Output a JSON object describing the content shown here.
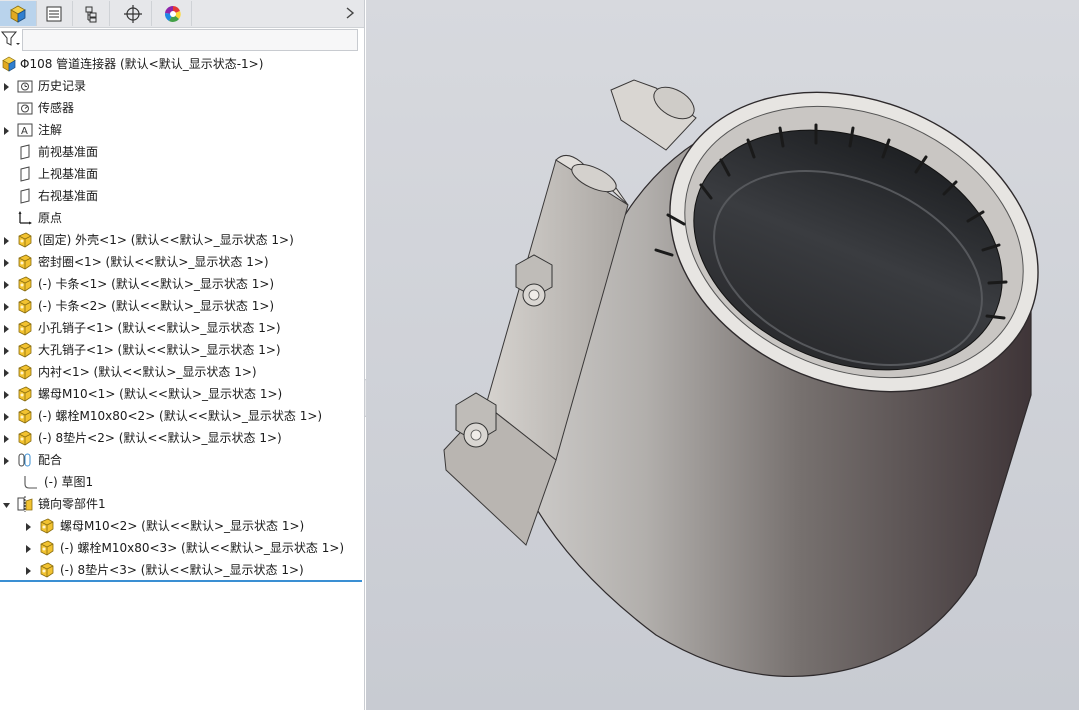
{
  "tabs": [
    {
      "name": "feature-manager",
      "icon": "assembly-cube-icon",
      "active": true
    },
    {
      "name": "property-manager",
      "icon": "property-list-icon",
      "active": false
    },
    {
      "name": "configuration-manager",
      "icon": "configuration-icon",
      "active": false
    },
    {
      "name": "dimxpert-manager",
      "icon": "crosshair-icon",
      "active": false
    },
    {
      "name": "display-manager",
      "icon": "color-wheel-icon",
      "active": false
    }
  ],
  "filter": {
    "icon": "funnel-icon"
  },
  "tree": {
    "root": "Φ108 管道连接器  (默认<默认_显示状态-1>)",
    "items": [
      {
        "label": "历史记录",
        "icon": "history-folder-icon",
        "arrow": true
      },
      {
        "label": "传感器",
        "icon": "sensor-icon",
        "arrow": false
      },
      {
        "label": "注解",
        "icon": "annotation-icon",
        "arrow": true
      },
      {
        "label": "前视基准面",
        "icon": "plane-icon",
        "arrow": false
      },
      {
        "label": "上视基准面",
        "icon": "plane-icon",
        "arrow": false
      },
      {
        "label": "右视基准面",
        "icon": "plane-icon",
        "arrow": false
      },
      {
        "label": "原点",
        "icon": "origin-icon",
        "arrow": false
      },
      {
        "label": "(固定) 外壳<1> (默认<<默认>_显示状态 1>)",
        "icon": "part-icon",
        "arrow": true
      },
      {
        "label": "密封圈<1> (默认<<默认>_显示状态 1>)",
        "icon": "part-icon",
        "arrow": true
      },
      {
        "label": "(-) 卡条<1> (默认<<默认>_显示状态 1>)",
        "icon": "part-icon",
        "arrow": true
      },
      {
        "label": "(-) 卡条<2> (默认<<默认>_显示状态 1>)",
        "icon": "part-icon",
        "arrow": true
      },
      {
        "label": "小孔销子<1> (默认<<默认>_显示状态 1>)",
        "icon": "part-icon",
        "arrow": true
      },
      {
        "label": "大孔销子<1> (默认<<默认>_显示状态 1>)",
        "icon": "part-icon",
        "arrow": true
      },
      {
        "label": "内衬<1> (默认<<默认>_显示状态 1>)",
        "icon": "part-icon",
        "arrow": true
      },
      {
        "label": "螺母M10<1> (默认<<默认>_显示状态 1>)",
        "icon": "part-icon",
        "arrow": true
      },
      {
        "label": "(-) 螺栓M10x80<2> (默认<<默认>_显示状态 1>)",
        "icon": "part-icon",
        "arrow": true
      },
      {
        "label": "(-) 8垫片<2> (默认<<默认>_显示状态 1>)",
        "icon": "part-icon",
        "arrow": true
      },
      {
        "label": "配合",
        "icon": "mate-icon",
        "arrow": true
      },
      {
        "label": "(-) 草图1",
        "icon": "sketch-icon",
        "arrow": false
      },
      {
        "label": "镜向零部件1",
        "icon": "mirror-components-icon",
        "arrow": "down"
      }
    ],
    "mirror_children": [
      {
        "label": "螺母M10<2> (默认<<默认>_显示状态 1>)",
        "icon": "part-icon",
        "arrow": true
      },
      {
        "label": "(-) 螺栓M10x80<3> (默认<<默认>_显示状态 1>)",
        "icon": "part-icon",
        "arrow": true
      },
      {
        "label": "(-) 8垫片<3> (默认<<默认>_显示状态 1>)",
        "icon": "part-icon",
        "arrow": true
      }
    ]
  },
  "colors": {
    "accent": "#3a8fd3",
    "part_yellow": "#f2c230",
    "tab_active": "#b9d3ec"
  }
}
